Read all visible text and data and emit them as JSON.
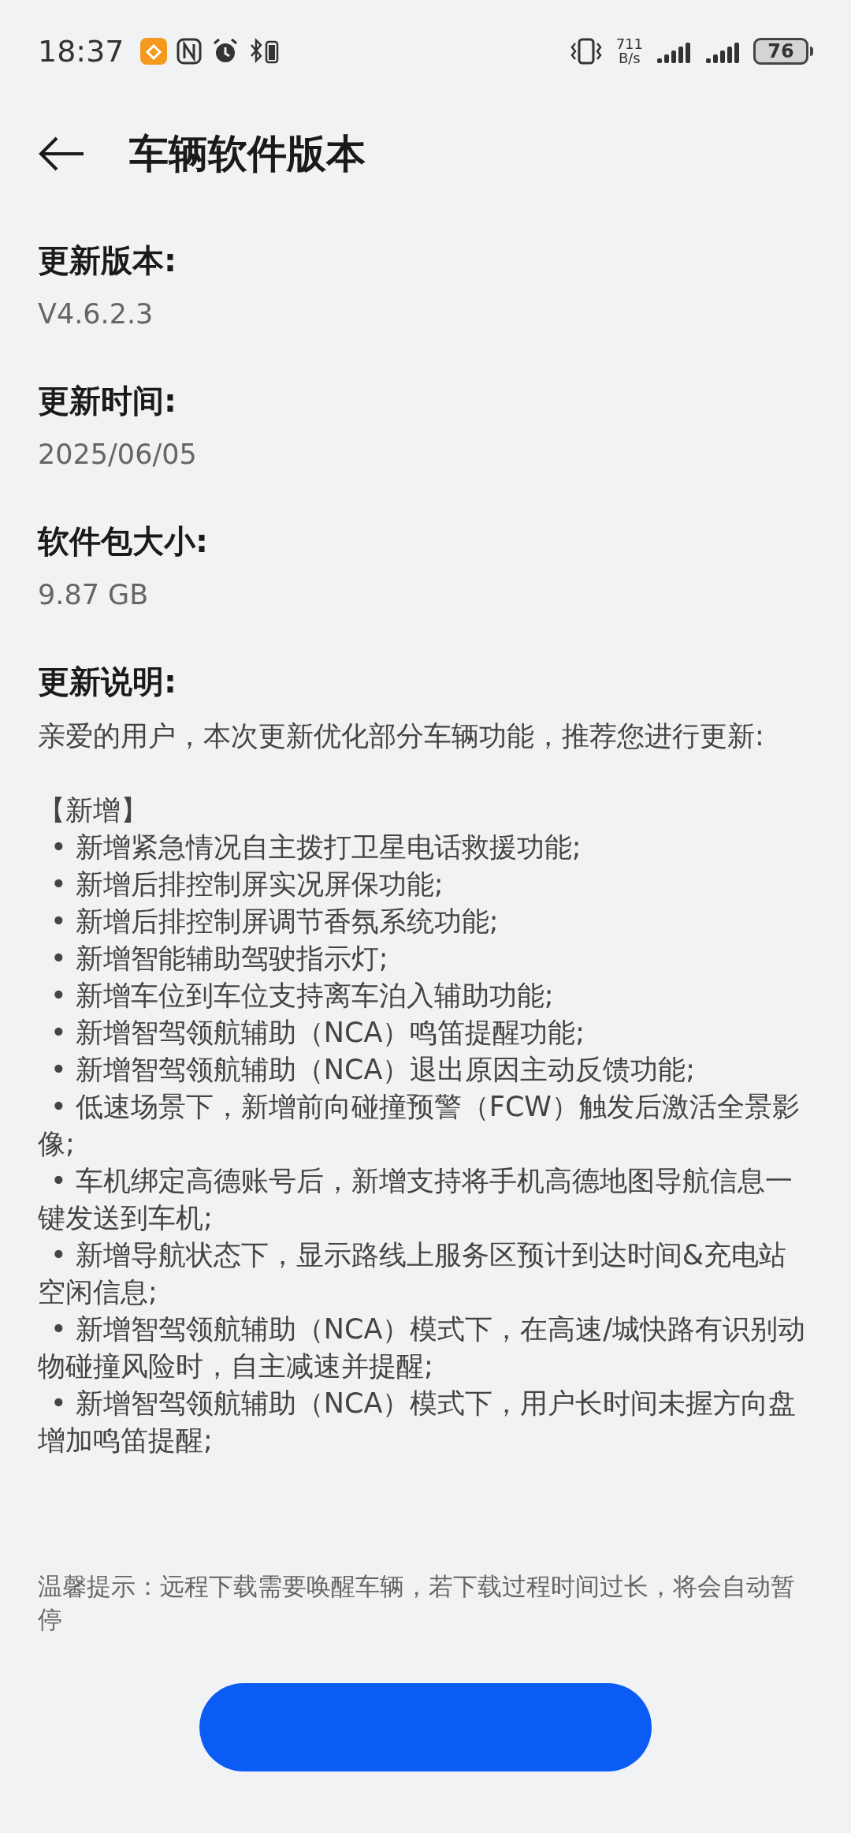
{
  "status_bar": {
    "time": "18:37",
    "speed_value": "711",
    "speed_unit": "B/s",
    "battery": "76"
  },
  "header": {
    "title": "车辆软件版本"
  },
  "fields": [
    {
      "label": "更新版本:",
      "value": "V4.6.2.3"
    },
    {
      "label": "更新时间:",
      "value": "2025/06/05"
    },
    {
      "label": "软件包大小:",
      "value": "9.87 GB"
    }
  ],
  "notes": {
    "label": "更新说明:",
    "intro": "亲爱的用户，本次更新优化部分车辆功能，推荐您进行更新:",
    "section": "【新增】",
    "items": [
      "•  新增紧急情况自主拨打卫星电话救援功能;",
      "•  新增后排控制屏实况屏保功能;",
      "•  新增后排控制屏调节香氛系统功能;",
      "•  新增智能辅助驾驶指示灯;",
      "•  新增车位到车位支持离车泊入辅助功能;",
      "•  新增智驾领航辅助（NCA）鸣笛提醒功能;",
      "•  新增智驾领航辅助（NCA）退出原因主动反馈功能;",
      "•  低速场景下，新增前向碰撞预警（FCW）触发后激活全景影像;",
      "•  车机绑定高德账号后，新增支持将手机高德地图导航信息一键发送到车机;",
      "•  新增导航状态下，显示路线上服务区预计到达时间&充电站空闲信息;",
      "•  新增智驾领航辅助（NCA）模式下，在高速/城快路有识别动物碰撞风险时，自主减速并提醒;",
      "•  新增智驾领航辅助（NCA）模式下，用户长时间未握方向盘增加鸣笛提醒;"
    ]
  },
  "tip": "温馨提示：远程下载需要唤醒车辆，若下载过程时间过长，将会自动暂停"
}
